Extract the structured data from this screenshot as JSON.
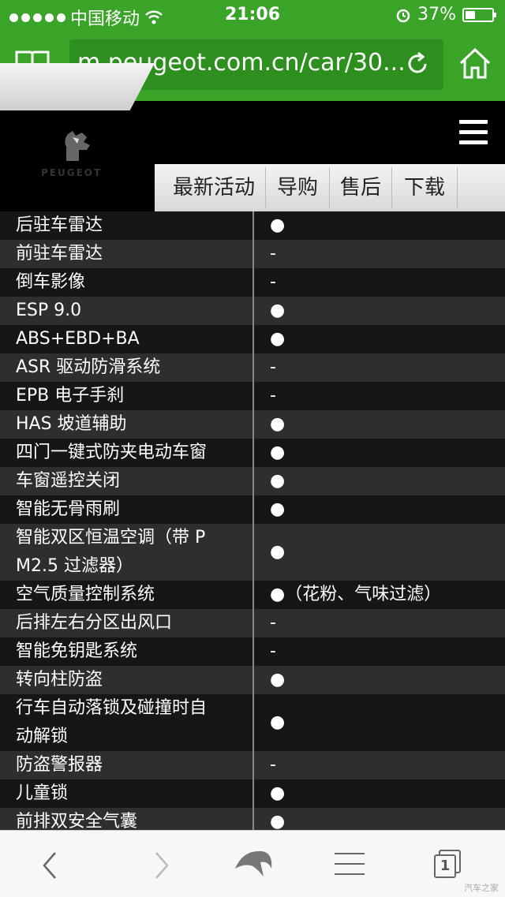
{
  "status": {
    "carrier": "中国移动",
    "time": "21:06",
    "battery_text": "37%",
    "battery_level": 0.37
  },
  "browser": {
    "url": "m.peugeot.com.cn/car/30..."
  },
  "site": {
    "brand": "PEUGEOT",
    "nav": [
      "最新活动",
      "导购",
      "售后",
      "下载"
    ]
  },
  "specs": [
    {
      "name_lines": [
        "后驻车雷达"
      ],
      "value": "●"
    },
    {
      "name_lines": [
        "前驻车雷达"
      ],
      "value": "-"
    },
    {
      "name_lines": [
        "倒车影像"
      ],
      "value": "-"
    },
    {
      "name_lines": [
        "ESP 9.0"
      ],
      "value": "●"
    },
    {
      "name_lines": [
        "ABS+EBD+BA"
      ],
      "value": "●"
    },
    {
      "name_lines": [
        "ASR 驱动防滑系统"
      ],
      "value": "-"
    },
    {
      "name_lines": [
        "EPB 电子手刹"
      ],
      "value": "-"
    },
    {
      "name_lines": [
        "HAS 坡道辅助"
      ],
      "value": "●"
    },
    {
      "name_lines": [
        "四门一键式防夹电动车窗"
      ],
      "value": "●"
    },
    {
      "name_lines": [
        "车窗遥控关闭"
      ],
      "value": "●"
    },
    {
      "name_lines": [
        "智能无骨雨刷"
      ],
      "value": "●"
    },
    {
      "name_lines": [
        "智能双区恒温空调（带 P",
        "M2.5 过滤器）"
      ],
      "value": "●"
    },
    {
      "name_lines": [
        "空气质量控制系统"
      ],
      "value": "●（花粉、气味过滤）"
    },
    {
      "name_lines": [
        "后排左右分区出风口"
      ],
      "value": "-"
    },
    {
      "name_lines": [
        "智能免钥匙系统"
      ],
      "value": "-"
    },
    {
      "name_lines": [
        "转向柱防盗"
      ],
      "value": "●"
    },
    {
      "name_lines": [
        "行车自动落锁及碰撞时自",
        "动解锁"
      ],
      "value": "●"
    },
    {
      "name_lines": [
        "防盗警报器"
      ],
      "value": "-"
    },
    {
      "name_lines": [
        "儿童锁"
      ],
      "value": "●"
    },
    {
      "name_lines": [
        "前排双安全气囊"
      ],
      "value": "●"
    }
  ],
  "toolbar": {
    "tabs_count": "1"
  },
  "watermark": "汽车之家"
}
